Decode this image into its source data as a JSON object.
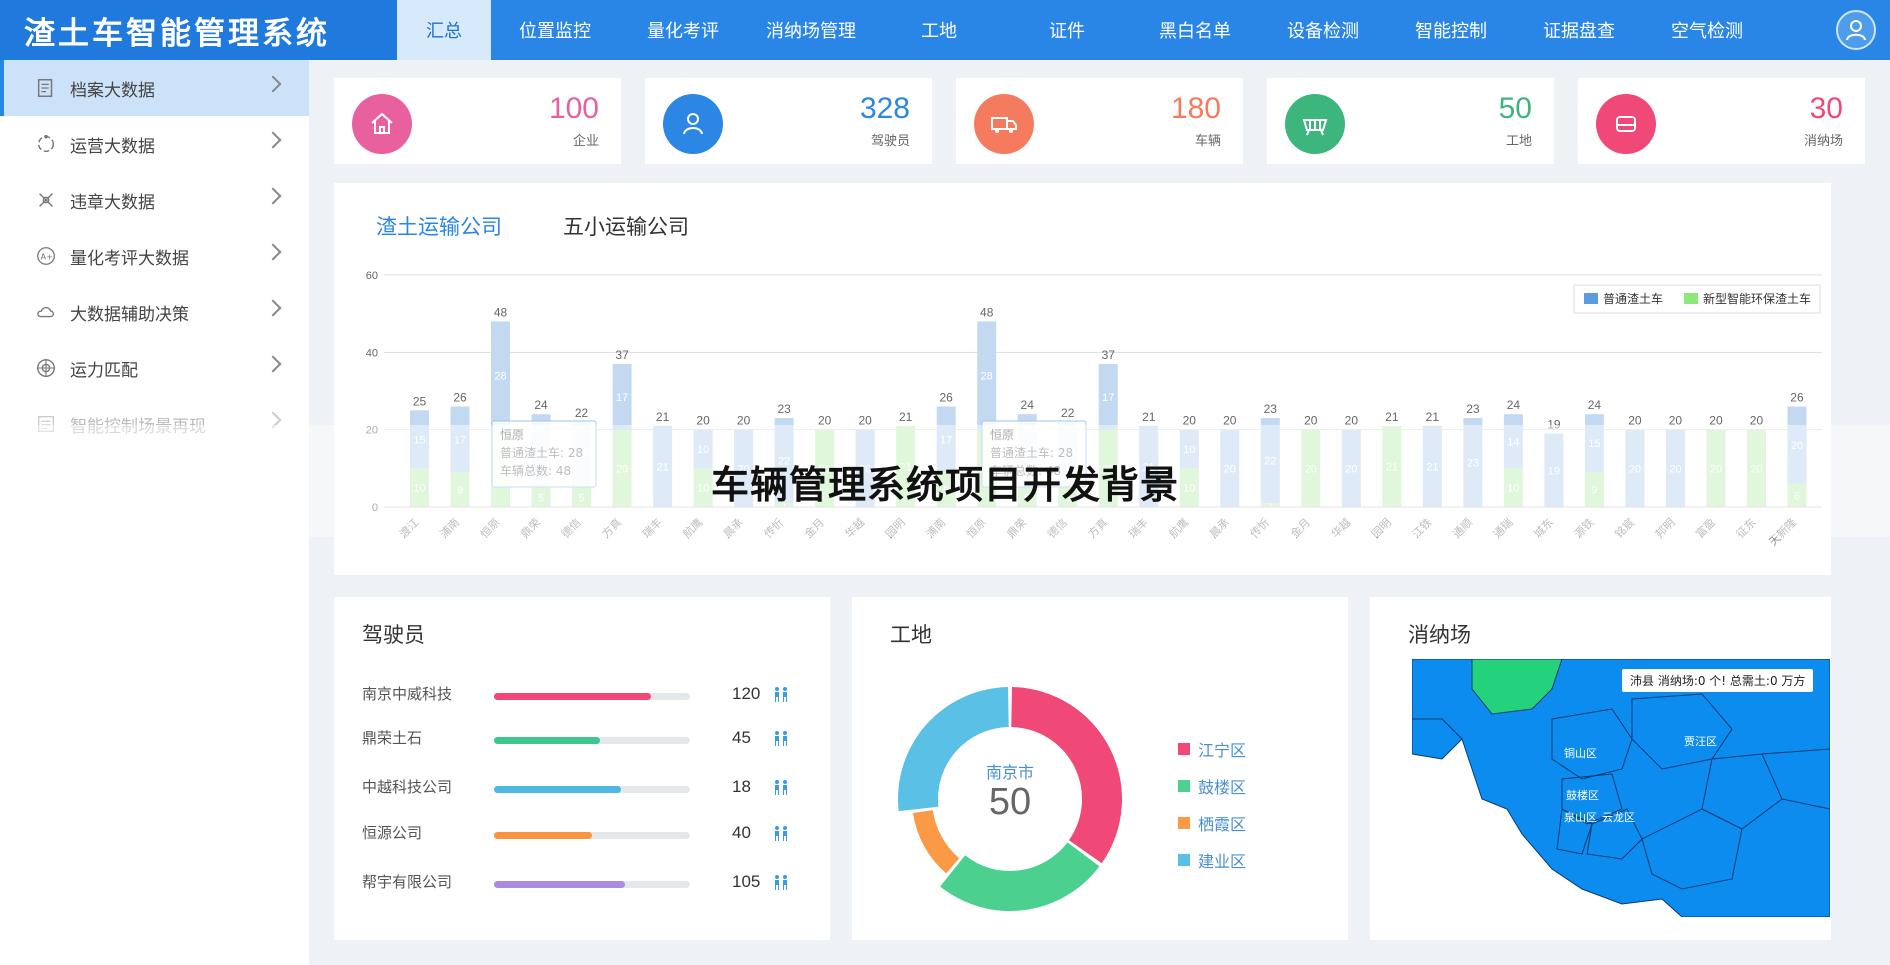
{
  "app": {
    "title": "渣土车智能管理系统"
  },
  "nav": {
    "items": [
      "汇总",
      "位置监控",
      "量化考评",
      "消纳场管理",
      "工地",
      "证件",
      "黑白名单",
      "设备检测",
      "智能控制",
      "证据盘查",
      "空气检测"
    ],
    "active_index": 0
  },
  "sidebar": {
    "items": [
      {
        "label": "档案大数据",
        "icon": "archive-icon",
        "state": "active"
      },
      {
        "label": "运营大数据",
        "icon": "operation-icon",
        "state": "normal"
      },
      {
        "label": "违章大数据",
        "icon": "violation-icon",
        "state": "normal"
      },
      {
        "label": "量化考评大数据",
        "icon": "rating-icon",
        "state": "normal"
      },
      {
        "label": "大数据辅助决策",
        "icon": "cloud-data-icon",
        "state": "normal"
      },
      {
        "label": "运力匹配",
        "icon": "target-icon",
        "state": "normal"
      },
      {
        "label": "智能控制场景再现",
        "icon": "scene-icon",
        "state": "disabled"
      }
    ]
  },
  "stats": [
    {
      "value": "100",
      "label": "企业",
      "color": "#e8609d",
      "icon": "house-icon"
    },
    {
      "value": "328",
      "label": "驾驶员",
      "color": "#2b86e4",
      "icon": "person-icon"
    },
    {
      "value": "180",
      "label": "车辆",
      "color": "#f57b5e",
      "icon": "truck-icon"
    },
    {
      "value": "50",
      "label": "工地",
      "color": "#3db67e",
      "icon": "site-icon"
    },
    {
      "value": "30",
      "label": "消纳场",
      "color": "#f04877",
      "icon": "dump-icon"
    }
  ],
  "chart_tabs": {
    "active": "渣土运输公司",
    "other": "五小运输公司"
  },
  "chart_data": {
    "type": "bar",
    "stacked": true,
    "ylim": [
      0,
      60
    ],
    "yticks": [
      0,
      20,
      40,
      60
    ],
    "legend_position": "top-right",
    "categories": [
      "渡江",
      "浦南",
      "恒原",
      "鼎荣",
      "德信",
      "方真",
      "瑞丰",
      "航鹰",
      "晨承",
      "传忻",
      "金月",
      "华越",
      "园明",
      "浦南",
      "恒原",
      "鼎荣",
      "德信",
      "方真",
      "瑞丰",
      "航鹰",
      "晨承",
      "传忻",
      "金月",
      "华越",
      "园明",
      "江铁",
      "通顺",
      "通瑞",
      "城东",
      "源铁",
      "铭宸",
      "邦明",
      "富盈",
      "征东",
      "天新隆"
    ],
    "series": [
      {
        "name": "普通渣土车",
        "color": "#5b9be0",
        "values": [
          15,
          17,
          28,
          19,
          17,
          17,
          21,
          10,
          20,
          22,
          0,
          20,
          0,
          17,
          28,
          19,
          17,
          17,
          21,
          10,
          20,
          22,
          0,
          20,
          0,
          21,
          23,
          14,
          19,
          15,
          20,
          20,
          0,
          0,
          20
        ]
      },
      {
        "name": "新型智能环保渣土车",
        "color": "#8de87a",
        "values": [
          10,
          9,
          20,
          5,
          5,
          20,
          0,
          10,
          0,
          1,
          20,
          0,
          21,
          9,
          20,
          5,
          5,
          20,
          0,
          10,
          0,
          1,
          20,
          0,
          21,
          0,
          0,
          10,
          0,
          9,
          0,
          0,
          20,
          20,
          6
        ]
      }
    ],
    "totals": [
      25,
      26,
      48,
      24,
      22,
      37,
      21,
      20,
      20,
      23,
      20,
      20,
      21,
      26,
      48,
      24,
      22,
      37,
      21,
      20,
      20,
      23,
      20,
      20,
      21,
      21,
      23,
      24,
      19,
      24,
      20,
      20,
      20,
      20,
      26
    ],
    "tooltip": {
      "title": "恒原",
      "line1": "普通渣土车: 28",
      "line2": "车辆总数: 48"
    }
  },
  "drivers": {
    "title": "驾驶员",
    "rows": [
      {
        "name": "南京中威科技",
        "count": "120",
        "ratio": 0.8,
        "color": "#f04877"
      },
      {
        "name": "鼎荣土石",
        "count": "45",
        "ratio": 0.54,
        "color": "#3ec78d"
      },
      {
        "name": "中越科技公司",
        "count": "18",
        "ratio": 0.65,
        "color": "#4fb8e0"
      },
      {
        "name": "恒源公司",
        "count": "40",
        "ratio": 0.5,
        "color": "#f7963e"
      },
      {
        "name": "帮宇有限公司",
        "count": "105",
        "ratio": 0.67,
        "color": "#a98be0"
      }
    ]
  },
  "sites": {
    "title": "工地",
    "center_label": "南京市",
    "center_value": "50",
    "segments": [
      {
        "name": "江宁区",
        "color": "#f04877",
        "value": 35
      },
      {
        "name": "鼓楼区",
        "color": "#4cd08f",
        "value": 26
      },
      {
        "name": "栖霞区",
        "color": "#fa9a47",
        "value": 12
      },
      {
        "name": "建业区",
        "color": "#5bc0e5",
        "value": 27
      }
    ]
  },
  "dump": {
    "title": "消纳场",
    "tooltip": "沛县 消纳场:0 个! 总需土:0 万方",
    "districts": [
      "铜山区",
      "贾汪区",
      "鼓楼区",
      "泉山区",
      "云龙区"
    ]
  },
  "banner": {
    "text": "车辆管理系统项目开发背景"
  }
}
